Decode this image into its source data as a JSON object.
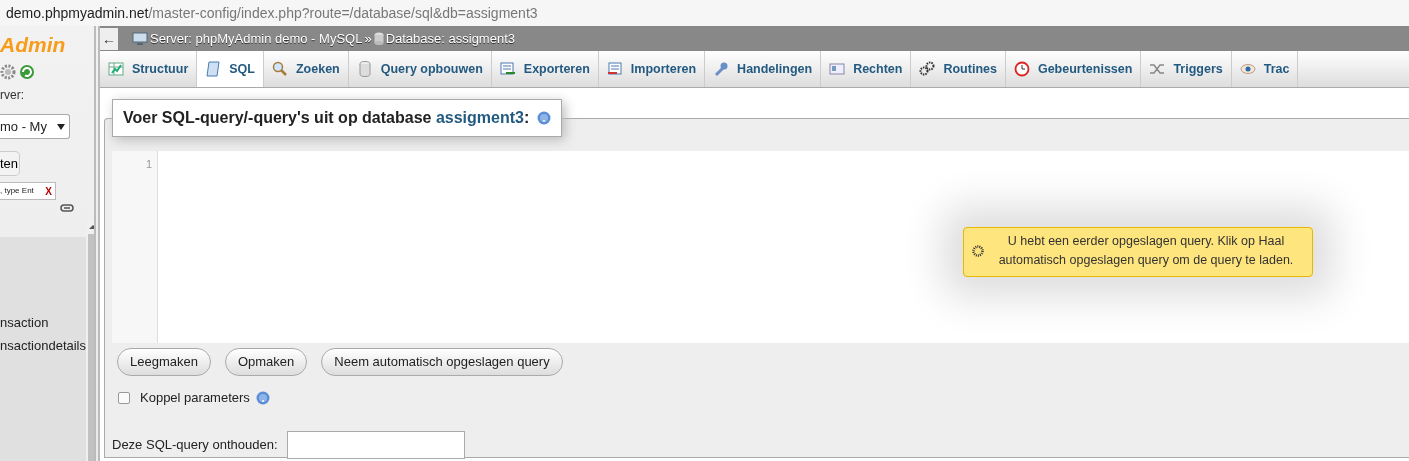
{
  "address_bar": {
    "host": "demo.phpmyadmin.net",
    "path": "/master-config/index.php?route=/database/sql&db=assigment3"
  },
  "sidebar": {
    "logo": "Admin",
    "server_label": "rver:",
    "server_select": "mo - My",
    "button": "ten",
    "filter_placeholder": ", type Ent",
    "filter_clear": "X",
    "tables": [
      {
        "name": "nsaction"
      },
      {
        "name": "nsactiondetails"
      }
    ]
  },
  "top_bar": {
    "back": "←",
    "breadcrumb": [
      {
        "kind": "server",
        "label": "Server: phpMyAdmin demo - MySQL"
      },
      {
        "kind": "database",
        "label": "Database: assigment3"
      }
    ],
    "separator": "»"
  },
  "tabs": [
    {
      "label": "Structuur",
      "selected": false
    },
    {
      "label": "SQL",
      "selected": true
    },
    {
      "label": "Zoeken",
      "selected": false
    },
    {
      "label": "Query opbouwen",
      "selected": false
    },
    {
      "label": "Exporteren",
      "selected": false
    },
    {
      "label": "Importeren",
      "selected": false
    },
    {
      "label": "Handelingen",
      "selected": false
    },
    {
      "label": "Rechten",
      "selected": false
    },
    {
      "label": "Routines",
      "selected": false
    },
    {
      "label": "Gebeurtenissen",
      "selected": false
    },
    {
      "label": "Triggers",
      "selected": false
    },
    {
      "label": "Trac",
      "selected": false
    }
  ],
  "legend": {
    "text": "Voer SQL-query/-query's uit op database",
    "database": "assigment3",
    "suffix": ":"
  },
  "editor": {
    "line_numbers": [
      "1"
    ]
  },
  "buttons": [
    "Leegmaken",
    "Opmaken",
    "Neem automatisch opgeslagen query"
  ],
  "bind_parameters": {
    "label": "Koppel parameters",
    "checked": false
  },
  "remember": {
    "label": "Deze SQL-query onthouden:"
  },
  "notice": {
    "text": "U hebt een eerder opgeslagen query. Klik op Haal automatisch opgeslagen query om de query te laden."
  }
}
